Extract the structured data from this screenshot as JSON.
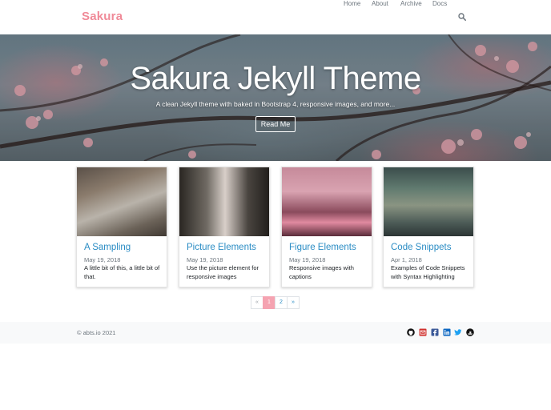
{
  "navbar": {
    "brand": "Sakura",
    "links": [
      {
        "label": "Home"
      },
      {
        "label": "About"
      },
      {
        "label": "Archive"
      },
      {
        "label": "Docs"
      }
    ],
    "search_icon": "search-icon"
  },
  "hero": {
    "title": "Sakura Jekyll Theme",
    "subtitle": "A clean Jekyll theme with baked in Bootstrap 4, responsive images, and more...",
    "button_label": "Read Me"
  },
  "posts": [
    {
      "title": "A Sampling",
      "date": "May 19, 2018",
      "excerpt": "A little bit of this, a little bit of that."
    },
    {
      "title": "Picture Elements",
      "date": "May 19, 2018",
      "excerpt": "Use the picture element for responsive images"
    },
    {
      "title": "Figure Elements",
      "date": "May 19, 2018",
      "excerpt": "Responsive images with captions"
    },
    {
      "title": "Code Snippets",
      "date": "Apr 1, 2018",
      "excerpt": "Examples of Code Snippets with Syntax Highlighting"
    }
  ],
  "pagination": {
    "prev": "«",
    "pages": [
      "1",
      "2"
    ],
    "current": "1",
    "next": "»"
  },
  "footer": {
    "copyright": "© abts.io 2021",
    "social_icons": [
      "github-icon",
      "email-icon",
      "facebook-icon",
      "linkedin-icon",
      "twitter-icon",
      "stackoverflow-icon"
    ]
  },
  "colors": {
    "brand": "#f08a98",
    "link": "#2a8cc4",
    "active_page": "#f5a3b1"
  }
}
